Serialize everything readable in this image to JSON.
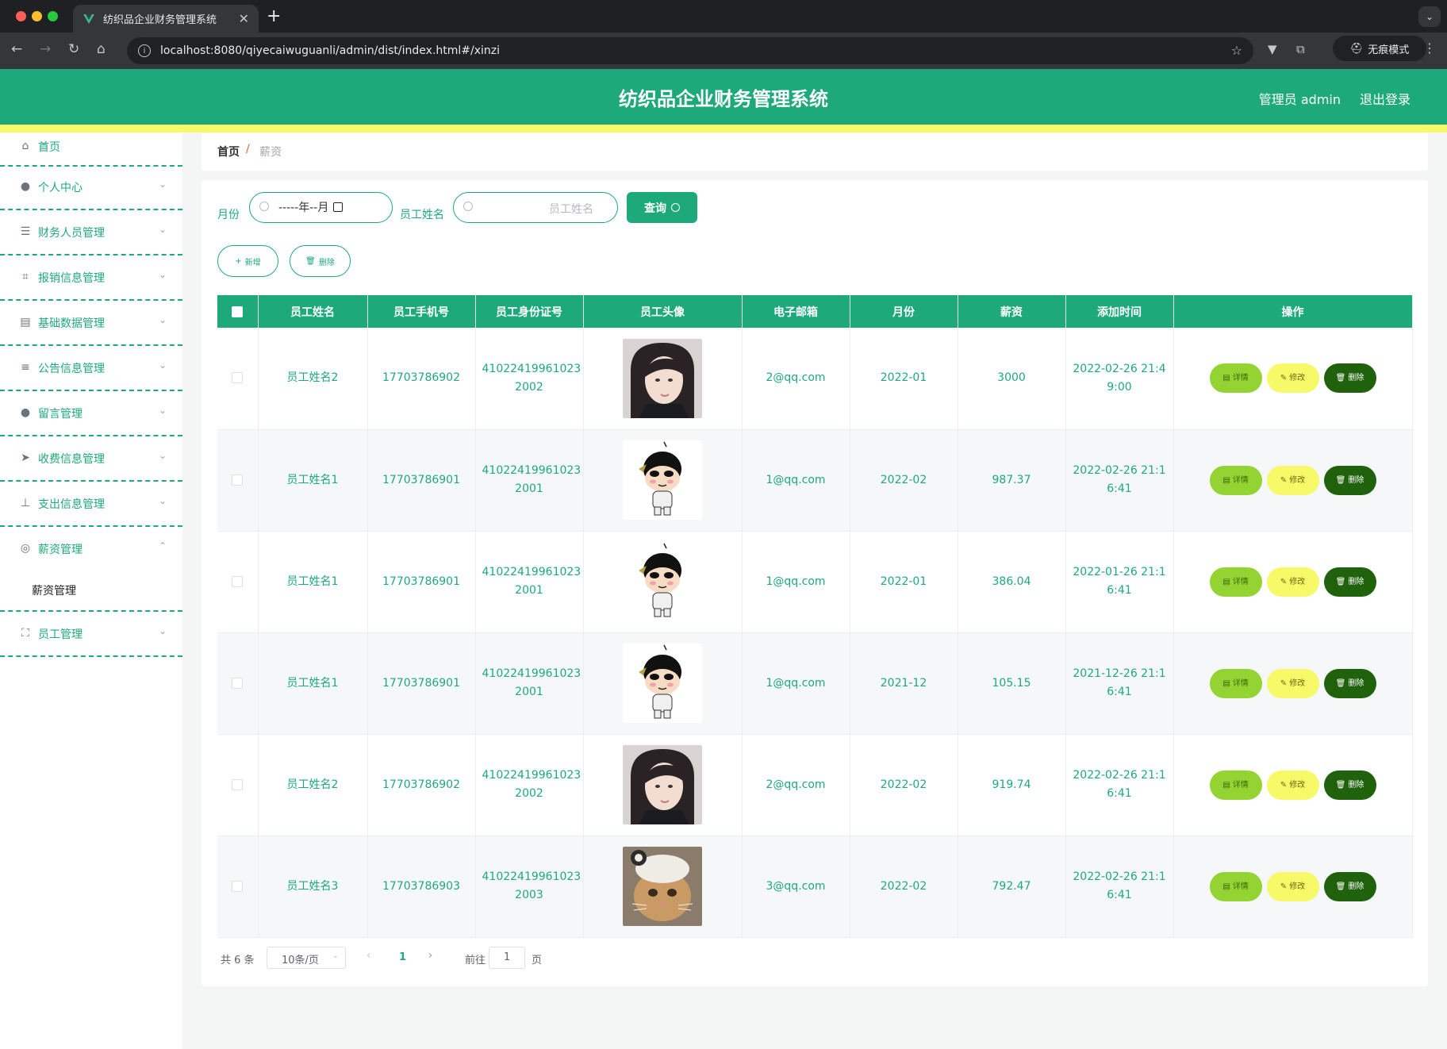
{
  "browser": {
    "tab_title": "纺织品企业财务管理系统",
    "url": "localhost:8080/qiyecaiwuguanli/admin/dist/index.html#/xinzi",
    "incognito_label": "无痕模式"
  },
  "header": {
    "title": "纺织品企业财务管理系统",
    "user_label": "管理员 admin",
    "logout_label": "退出登录"
  },
  "sidebar": {
    "items": [
      {
        "label": "首页",
        "icon": "home-icon"
      },
      {
        "label": "个人中心",
        "icon": "user-icon"
      },
      {
        "label": "财务人员管理",
        "icon": "sliders-icon"
      },
      {
        "label": "报销信息管理",
        "icon": "crop-icon"
      },
      {
        "label": "基础数据管理",
        "icon": "clipboard-icon"
      },
      {
        "label": "公告信息管理",
        "icon": "list-icon"
      },
      {
        "label": "留言管理",
        "icon": "user-icon"
      },
      {
        "label": "收费信息管理",
        "icon": "send-icon"
      },
      {
        "label": "支出信息管理",
        "icon": "stamp-icon"
      },
      {
        "label": "薪资管理",
        "icon": "compass-icon"
      },
      {
        "label": "员工管理",
        "icon": "fullscreen-icon"
      }
    ],
    "subitem": "薪资管理"
  },
  "breadcrumb": {
    "home": "首页",
    "separator": "/",
    "current": "薪资"
  },
  "filters": {
    "month_label": "月份",
    "month_value": "-----年--月",
    "name_label": "员工姓名",
    "name_placeholder": "员工姓名",
    "search_label": "查询"
  },
  "actions": {
    "add_label": "新增",
    "delete_label": "删除"
  },
  "table": {
    "headers": [
      "员工姓名",
      "员工手机号",
      "员工身份证号",
      "员工头像",
      "电子邮箱",
      "月份",
      "薪资",
      "添加时间",
      "操作"
    ],
    "rows": [
      {
        "name": "员工姓名2",
        "phone": "17703786902",
        "id1": "41022419961023",
        "id2": "2002",
        "avatar": "photo-girl",
        "email": "2@qq.com",
        "month": "2022-01",
        "salary": "3000",
        "t1": "2022-02-26 21:4",
        "t2": "9:00"
      },
      {
        "name": "员工姓名1",
        "phone": "17703786901",
        "id1": "41022419961023",
        "id2": "2001",
        "avatar": "cartoon-boy",
        "email": "1@qq.com",
        "month": "2022-02",
        "salary": "987.37",
        "t1": "2022-02-26 21:1",
        "t2": "6:41"
      },
      {
        "name": "员工姓名1",
        "phone": "17703786901",
        "id1": "41022419961023",
        "id2": "2001",
        "avatar": "cartoon-boy",
        "email": "1@qq.com",
        "month": "2022-01",
        "salary": "386.04",
        "t1": "2022-01-26 21:1",
        "t2": "6:41"
      },
      {
        "name": "员工姓名1",
        "phone": "17703786901",
        "id1": "41022419961023",
        "id2": "2001",
        "avatar": "cartoon-boy",
        "email": "1@qq.com",
        "month": "2021-12",
        "salary": "105.15",
        "t1": "2021-12-26 21:1",
        "t2": "6:41"
      },
      {
        "name": "员工姓名2",
        "phone": "17703786902",
        "id1": "41022419961023",
        "id2": "2002",
        "avatar": "photo-girl",
        "email": "2@qq.com",
        "month": "2022-02",
        "salary": "919.74",
        "t1": "2022-02-26 21:1",
        "t2": "6:41"
      },
      {
        "name": "员工姓名3",
        "phone": "17703786903",
        "id1": "41022419961023",
        "id2": "2003",
        "avatar": "photo-cat",
        "email": "3@qq.com",
        "month": "2022-02",
        "salary": "792.47",
        "t1": "2022-02-26 21:1",
        "t2": "6:41"
      }
    ],
    "op_detail": "详情",
    "op_edit": "修改",
    "op_delete": "删除"
  },
  "pagination": {
    "total": "共 6 条",
    "page_size": "10条/页",
    "current_page": "1",
    "goto_label": "前往",
    "goto_value": "1",
    "page_suffix": "页"
  },
  "colors": {
    "primary": "#1ea97a",
    "accent_yellow": "#f6f968",
    "detail_green": "#93d432",
    "delete_dark": "#20610b"
  }
}
